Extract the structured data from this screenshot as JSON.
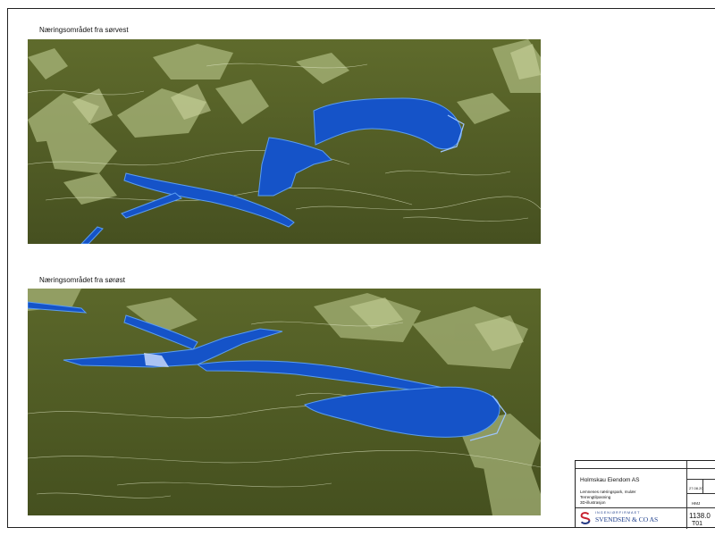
{
  "views": [
    {
      "caption": "Næringsområdet fra sørvest"
    },
    {
      "caption": "Næringsområdet fra sørøst"
    }
  ],
  "title_block": {
    "client": "Holmskau Eiendom AS",
    "project_line1": "Lemnenes næringspark, mulær",
    "project_line2": "Terrengtilpasning",
    "project_line3": "3D-illustrasjon",
    "date": "27.08.20",
    "drawn_by": "HMJ",
    "project_number": "1138.0",
    "drawing_number": "T01",
    "company": "SVENDSEN & CO AS",
    "company_tagline": "INGENIØRFIRMAET",
    "colors": {
      "terrain": "#4e5a22",
      "terrain_light": "#b4c08a",
      "water": "#1553c8",
      "water_edge": "#5b9df0",
      "logo_red": "#c8202e",
      "logo_blue": "#1e3f8c"
    }
  }
}
